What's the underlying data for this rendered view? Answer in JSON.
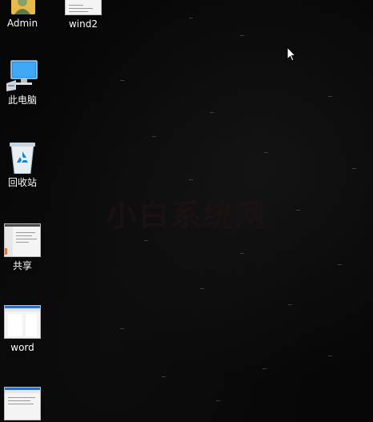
{
  "desktop": {
    "watermark": "小白系统网",
    "icons": [
      {
        "label": "Admin",
        "icon": "user-folder-icon"
      },
      {
        "label": "wind2",
        "icon": "document-thumbnail-icon"
      },
      {
        "label": "此电脑",
        "icon": "computer-icon"
      },
      {
        "label": "回收站",
        "icon": "recycle-bin-icon"
      },
      {
        "label": "共享",
        "icon": "folder-thumbnail-icon"
      },
      {
        "label": "word",
        "icon": "document-thumbnail-icon"
      },
      {
        "label": "",
        "icon": "document-thumbnail-icon"
      }
    ]
  },
  "colors": {
    "background": "#070707",
    "label_text": "#ffffff",
    "accent": "#2f6fc4"
  }
}
